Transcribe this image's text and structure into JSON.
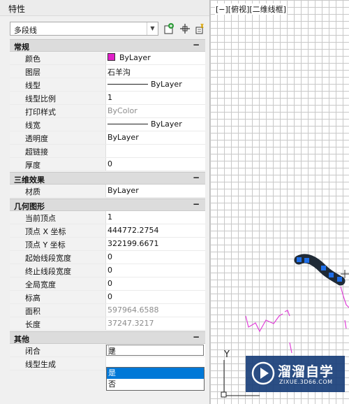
{
  "panel": {
    "title": "特性",
    "object_type": "多段线",
    "toolbar_icons": [
      "select-objects-icon",
      "pick-add-icon",
      "quick-select-icon"
    ]
  },
  "sections": {
    "general": {
      "title": "常规",
      "collapse": "−",
      "rows": [
        {
          "label": "颜色",
          "value": "ByLayer"
        },
        {
          "label": "图层",
          "value": "石羊沟"
        },
        {
          "label": "线型",
          "value": "ByLayer"
        },
        {
          "label": "线型比例",
          "value": "1"
        },
        {
          "label": "打印样式",
          "value": "ByColor"
        },
        {
          "label": "线宽",
          "value": "ByLayer"
        },
        {
          "label": "透明度",
          "value": "ByLayer"
        },
        {
          "label": "超链接",
          "value": ""
        },
        {
          "label": "厚度",
          "value": "0"
        }
      ]
    },
    "effects3d": {
      "title": "三维效果",
      "collapse": "−",
      "rows": [
        {
          "label": "材质",
          "value": "ByLayer"
        }
      ]
    },
    "geometry": {
      "title": "几何图形",
      "collapse": "−",
      "rows": [
        {
          "label": "当前顶点",
          "value": "1"
        },
        {
          "label": "顶点 X 坐标",
          "value": "444772.2754"
        },
        {
          "label": "顶点 Y 坐标",
          "value": "322199.6671"
        },
        {
          "label": "起始线段宽度",
          "value": "0"
        },
        {
          "label": "终止线段宽度",
          "value": "0"
        },
        {
          "label": "全局宽度",
          "value": "0"
        },
        {
          "label": "标高",
          "value": "0"
        },
        {
          "label": "面积",
          "value": "597964.6588"
        },
        {
          "label": "长度",
          "value": "37247.3217"
        }
      ]
    },
    "misc": {
      "title": "其他",
      "collapse": "−",
      "rows": [
        {
          "label": "闭合",
          "value": "是"
        },
        {
          "label": "线型生成",
          "value": ""
        }
      ]
    }
  },
  "dropdown": {
    "options": [
      "是",
      "否"
    ],
    "highlighted": "是"
  },
  "viewport": {
    "label": "[−][俯视][二维线框]",
    "axis_label": "Y"
  },
  "watermark": {
    "title": "溜溜自学",
    "site": "ZIXUE.3D66.COM"
  },
  "colors": {
    "layer_color": "#e020c8",
    "selection_blue": "#0078d7",
    "grip_blue": "#1e6ee8",
    "polyline_magenta": "#e040d8"
  }
}
